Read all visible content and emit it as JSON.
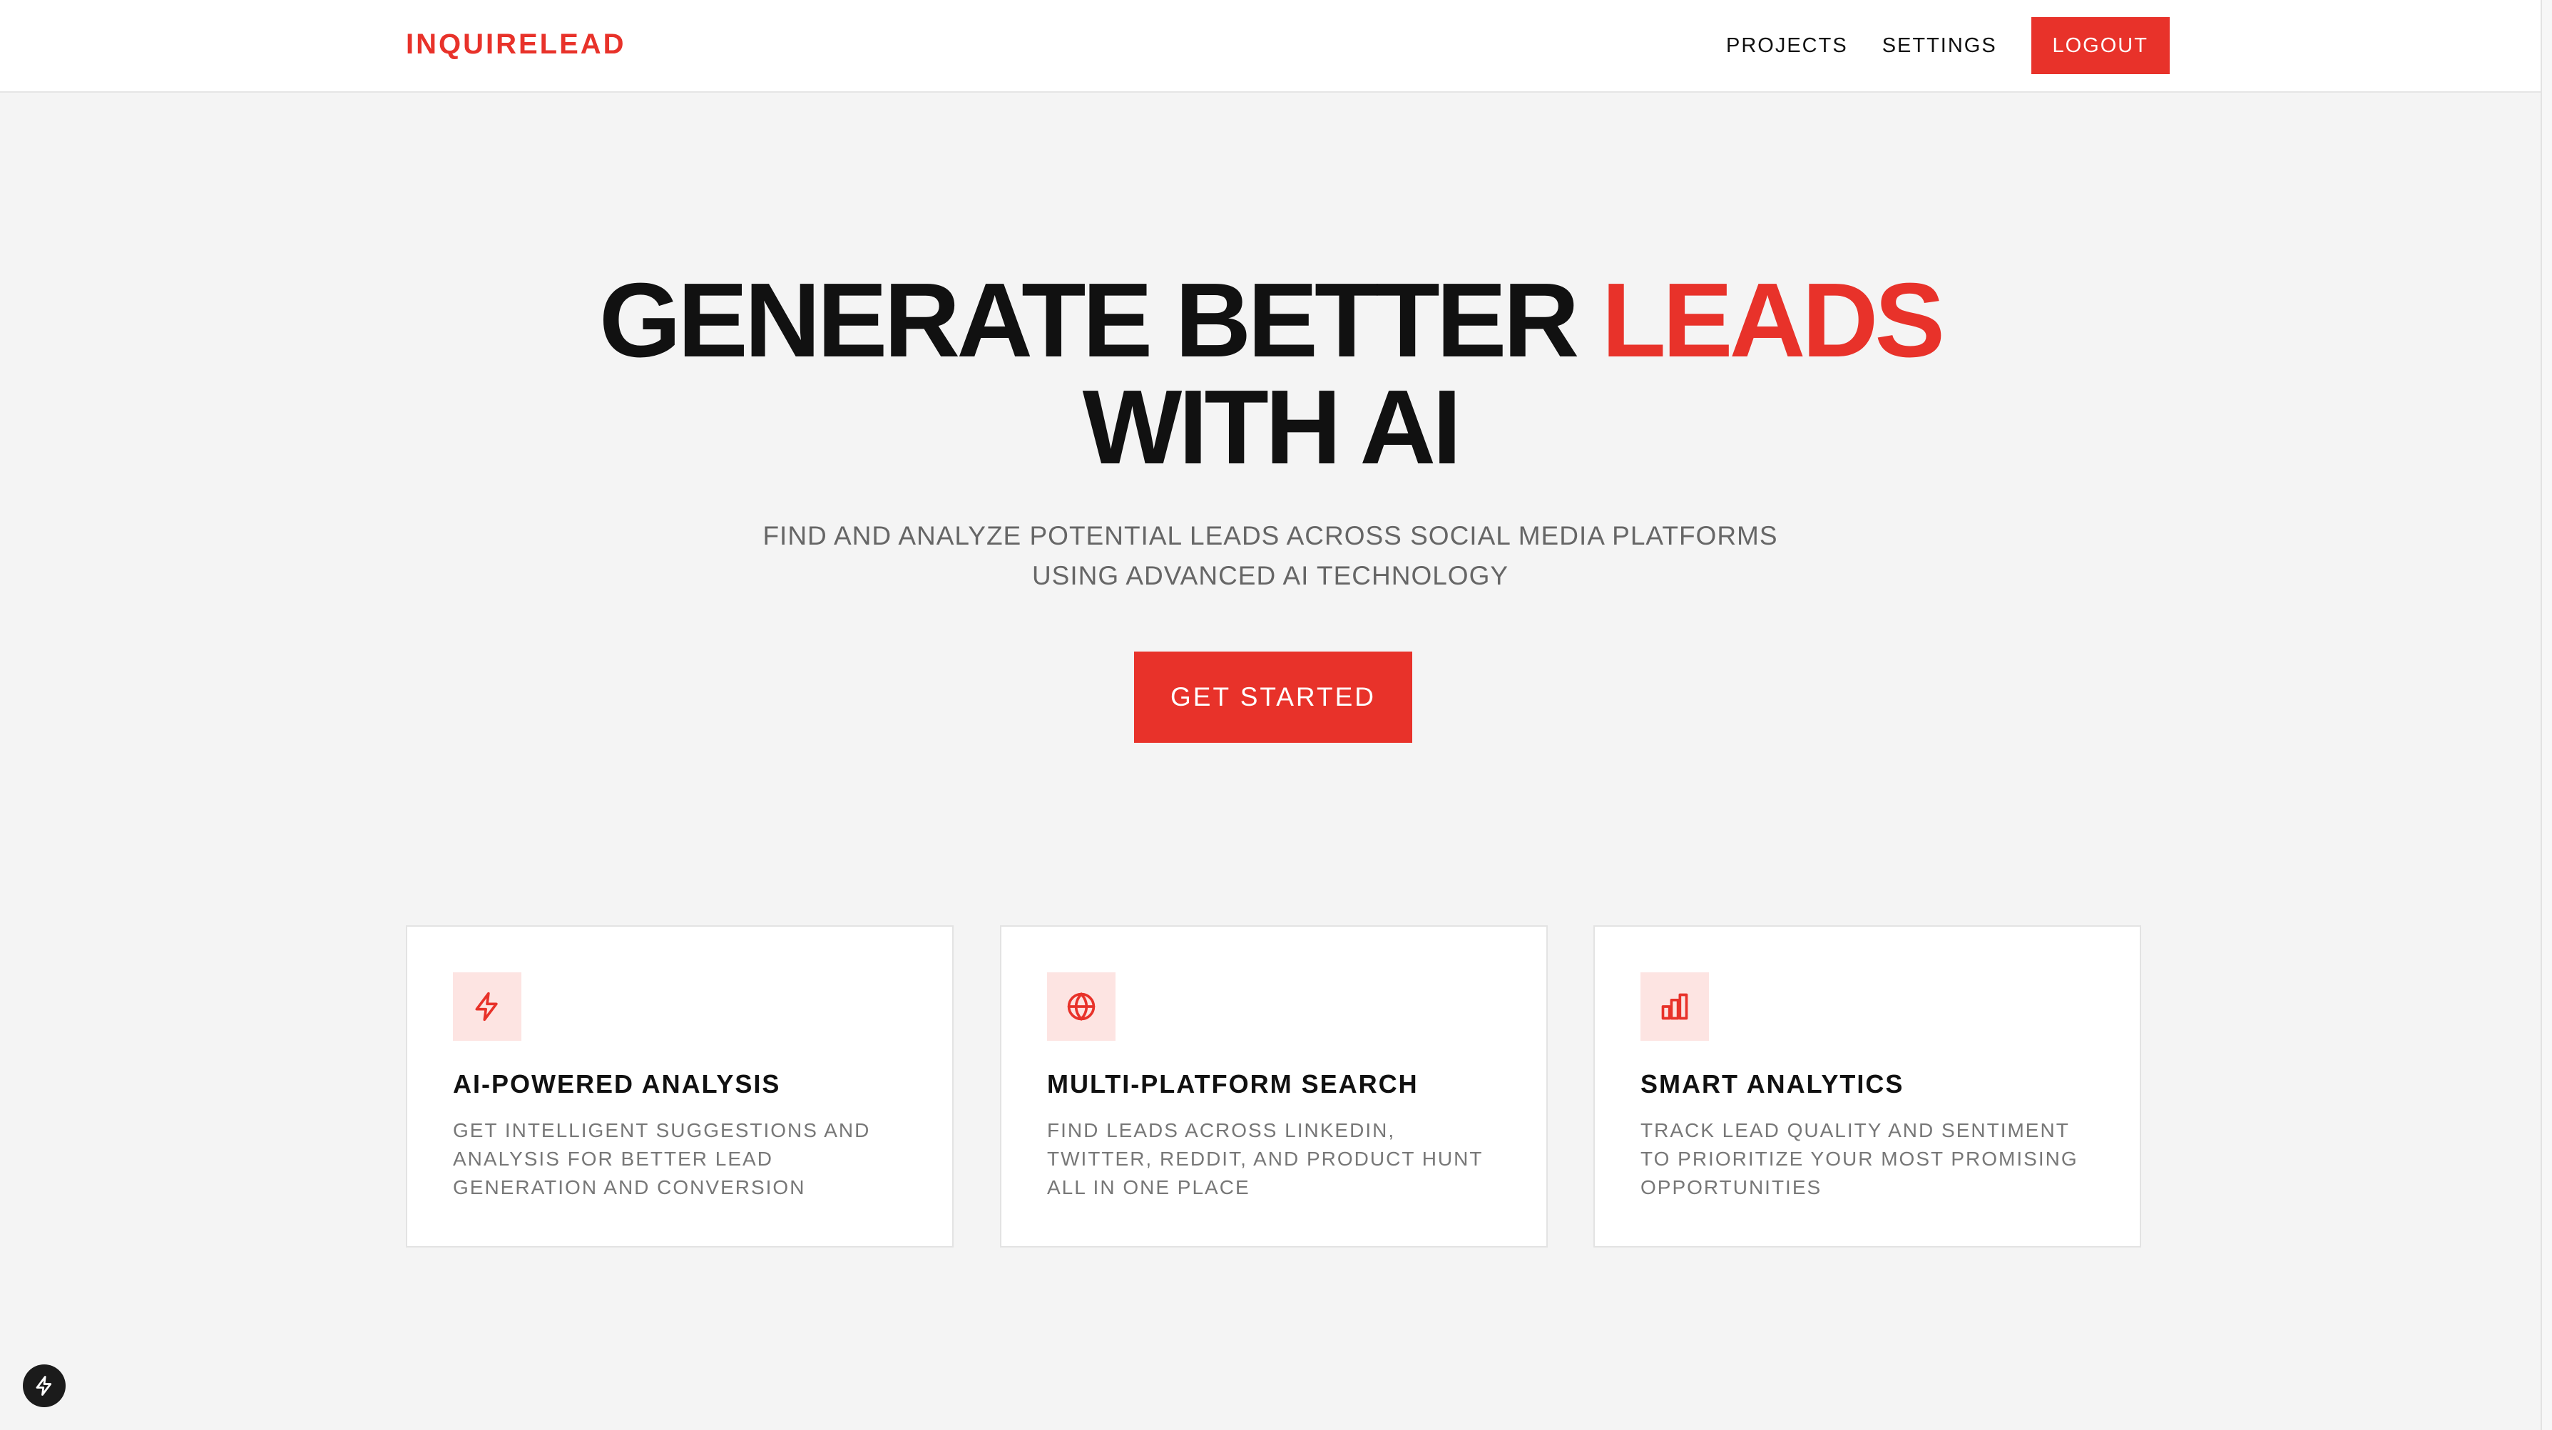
{
  "header": {
    "brand": "INQUIRELEAD",
    "nav": {
      "projects": "PROJECTS",
      "settings": "SETTINGS",
      "logout": "LOGOUT"
    }
  },
  "hero": {
    "title_part1": "GENERATE BETTER ",
    "title_accent": "LEADS",
    "title_line2": "WITH AI",
    "subtitle_line1": "FIND AND ANALYZE POTENTIAL LEADS ACROSS SOCIAL MEDIA PLATFORMS",
    "subtitle_line2": "USING ADVANCED AI TECHNOLOGY",
    "cta_label": "GET STARTED"
  },
  "features": [
    {
      "icon": "lightning-icon",
      "title": "AI-POWERED ANALYSIS",
      "description": "GET INTELLIGENT SUGGESTIONS AND ANALYSIS FOR BETTER LEAD GENERATION AND CONVERSION"
    },
    {
      "icon": "globe-icon",
      "title": "MULTI-PLATFORM SEARCH",
      "description": "FIND LEADS ACROSS LINKEDIN, TWITTER, REDDIT, AND PRODUCT HUNT ALL IN ONE PLACE"
    },
    {
      "icon": "bar-chart-icon",
      "title": "SMART ANALYTICS",
      "description": "TRACK LEAD QUALITY AND SENTIMENT TO PRIORITIZE YOUR MOST PROMISING OPPORTUNITIES"
    }
  ],
  "colors": {
    "accent": "#e8322a",
    "accent_soft": "#fde4e2",
    "background": "#f4f4f4"
  },
  "floating_button": {
    "icon": "lightning-icon"
  }
}
